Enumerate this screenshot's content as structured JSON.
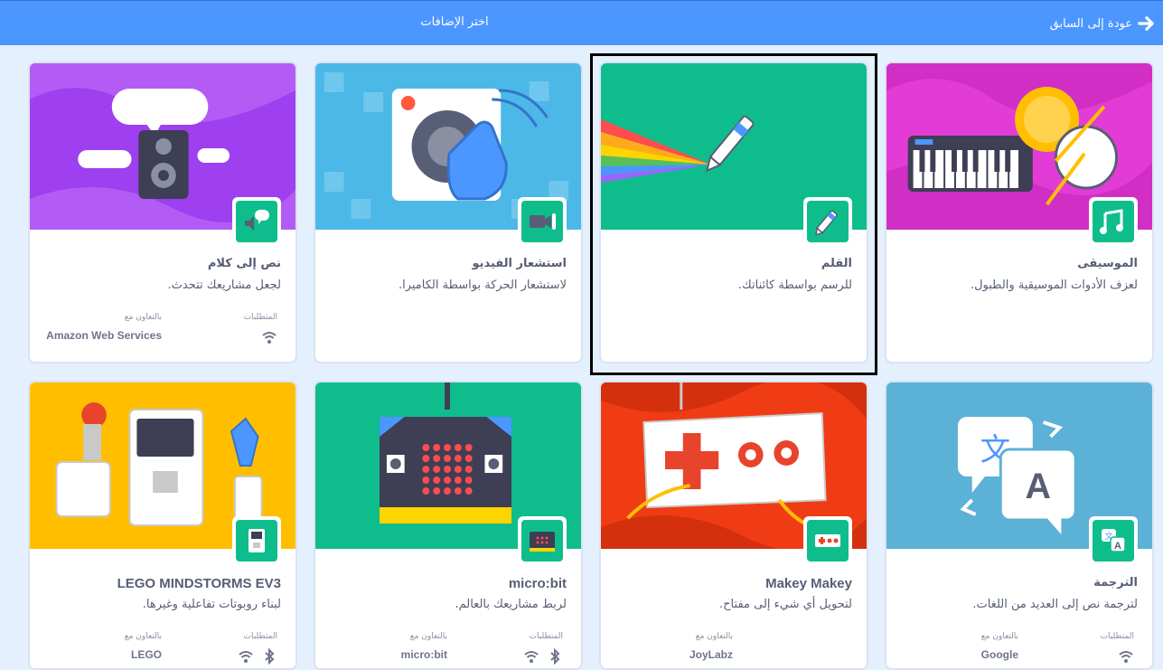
{
  "header": {
    "title": "اختر الإضافات",
    "back_label": "عودة إلى السابق"
  },
  "labels": {
    "requirements": "المتطلبات",
    "collaboration": "بالتعاون مع"
  },
  "extensions": [
    {
      "id": "music",
      "name": "الموسيقى",
      "description": "لعزف الأدوات الموسيقية والطبول."
    },
    {
      "id": "pen",
      "name": "القلم",
      "description": "للرسم بواسطة كائناتك."
    },
    {
      "id": "video",
      "name": "استشعار الفيديو",
      "description": "لاستشعار الحركة بواسطة الكاميرا."
    },
    {
      "id": "tts",
      "name": "نص إلى كلام",
      "description": "لجعل مشاريعك تتحدث.",
      "collaborator": "Amazon Web Services"
    },
    {
      "id": "translate",
      "name": "الترجمة",
      "description": "لترجمة نص إلى العديد من اللغات.",
      "collaborator": "Google"
    },
    {
      "id": "makey",
      "name": "Makey Makey",
      "description": "لتحويل أي شيء إلى مفتاح.",
      "collaborator": "JoyLabz"
    },
    {
      "id": "microbit",
      "name": "micro:bit",
      "description": "لربط مشاريعك بالعالم.",
      "collaborator": "micro:bit"
    },
    {
      "id": "ev3",
      "name": "LEGO MINDSTORMS EV3",
      "description": "لبناء روبوتات تفاعلية وغيرها.",
      "collaborator": "LEGO"
    }
  ],
  "colors": {
    "header": "#4c97ff",
    "badge": "#0fbd8c",
    "music": "#e33cd6",
    "pen": "#0fbd8c",
    "video": "#4cb8e8",
    "tts": "#9e3ff0",
    "translate": "#5cb1d6",
    "makey": "#f03c14",
    "microbit": "#0fbd8c",
    "ev3": "#ffbf00"
  }
}
